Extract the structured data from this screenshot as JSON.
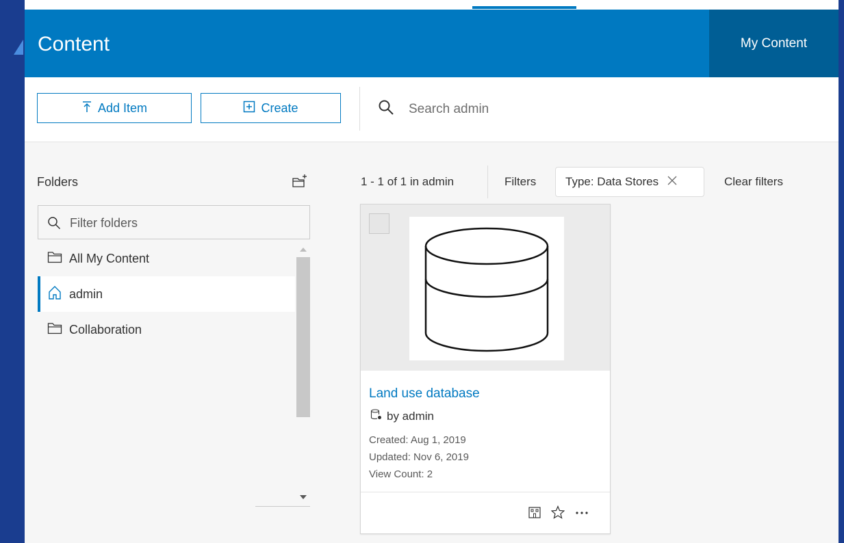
{
  "topbar": {},
  "header": {
    "title": "Content",
    "tab_my_content": "My Content"
  },
  "toolbar": {
    "add_item_label": "Add Item",
    "create_label": "Create",
    "search_placeholder": "Search admin"
  },
  "folders": {
    "title": "Folders",
    "filter_placeholder": "Filter folders",
    "items": [
      {
        "label": "All My Content",
        "icon": "folder-icon",
        "selected": false
      },
      {
        "label": "admin",
        "icon": "home-icon",
        "selected": true
      },
      {
        "label": "Collaboration",
        "icon": "folder-icon",
        "selected": false
      }
    ]
  },
  "results": {
    "count_text": "1 - 1 of 1 in admin",
    "filters_label": "Filters",
    "chip_label": "Type: Data Stores",
    "clear_filters": "Clear filters"
  },
  "card": {
    "title": "Land use database",
    "owner": "by admin",
    "created": "Created: Aug 1, 2019",
    "updated": "Updated: Nov 6, 2019",
    "view_count": "View Count: 2",
    "thumbnail_icon": "database-icon"
  },
  "colors": {
    "accent": "#0079c1",
    "tab_active": "#005e95",
    "frame_bg": "#1a3d8f"
  }
}
